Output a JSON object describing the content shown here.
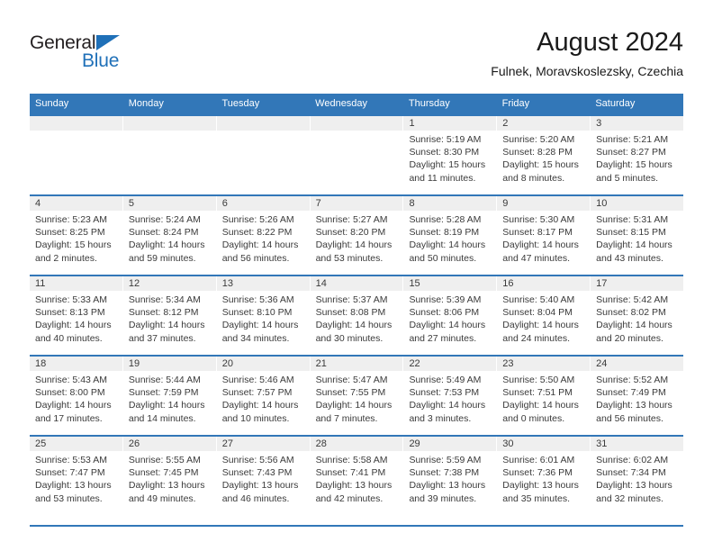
{
  "brand": {
    "name_primary": "General",
    "name_secondary": "Blue",
    "accent_color": "#1f70b8"
  },
  "header": {
    "title": "August 2024",
    "subtitle": "Fulnek, Moravskoslezsky, Czechia"
  },
  "theme": {
    "header_row_color": "#3277b8",
    "day_band_color": "#efefef",
    "text_color": "#3a3a3a"
  },
  "weekday_headers": [
    "Sunday",
    "Monday",
    "Tuesday",
    "Wednesday",
    "Thursday",
    "Friday",
    "Saturday"
  ],
  "weeks": [
    [
      {
        "day": "",
        "sunrise": "",
        "sunset": "",
        "daylight_line1": "",
        "daylight_line2": ""
      },
      {
        "day": "",
        "sunrise": "",
        "sunset": "",
        "daylight_line1": "",
        "daylight_line2": ""
      },
      {
        "day": "",
        "sunrise": "",
        "sunset": "",
        "daylight_line1": "",
        "daylight_line2": ""
      },
      {
        "day": "",
        "sunrise": "",
        "sunset": "",
        "daylight_line1": "",
        "daylight_line2": ""
      },
      {
        "day": "1",
        "sunrise": "Sunrise: 5:19 AM",
        "sunset": "Sunset: 8:30 PM",
        "daylight_line1": "Daylight: 15 hours",
        "daylight_line2": "and 11 minutes."
      },
      {
        "day": "2",
        "sunrise": "Sunrise: 5:20 AM",
        "sunset": "Sunset: 8:28 PM",
        "daylight_line1": "Daylight: 15 hours",
        "daylight_line2": "and 8 minutes."
      },
      {
        "day": "3",
        "sunrise": "Sunrise: 5:21 AM",
        "sunset": "Sunset: 8:27 PM",
        "daylight_line1": "Daylight: 15 hours",
        "daylight_line2": "and 5 minutes."
      }
    ],
    [
      {
        "day": "4",
        "sunrise": "Sunrise: 5:23 AM",
        "sunset": "Sunset: 8:25 PM",
        "daylight_line1": "Daylight: 15 hours",
        "daylight_line2": "and 2 minutes."
      },
      {
        "day": "5",
        "sunrise": "Sunrise: 5:24 AM",
        "sunset": "Sunset: 8:24 PM",
        "daylight_line1": "Daylight: 14 hours",
        "daylight_line2": "and 59 minutes."
      },
      {
        "day": "6",
        "sunrise": "Sunrise: 5:26 AM",
        "sunset": "Sunset: 8:22 PM",
        "daylight_line1": "Daylight: 14 hours",
        "daylight_line2": "and 56 minutes."
      },
      {
        "day": "7",
        "sunrise": "Sunrise: 5:27 AM",
        "sunset": "Sunset: 8:20 PM",
        "daylight_line1": "Daylight: 14 hours",
        "daylight_line2": "and 53 minutes."
      },
      {
        "day": "8",
        "sunrise": "Sunrise: 5:28 AM",
        "sunset": "Sunset: 8:19 PM",
        "daylight_line1": "Daylight: 14 hours",
        "daylight_line2": "and 50 minutes."
      },
      {
        "day": "9",
        "sunrise": "Sunrise: 5:30 AM",
        "sunset": "Sunset: 8:17 PM",
        "daylight_line1": "Daylight: 14 hours",
        "daylight_line2": "and 47 minutes."
      },
      {
        "day": "10",
        "sunrise": "Sunrise: 5:31 AM",
        "sunset": "Sunset: 8:15 PM",
        "daylight_line1": "Daylight: 14 hours",
        "daylight_line2": "and 43 minutes."
      }
    ],
    [
      {
        "day": "11",
        "sunrise": "Sunrise: 5:33 AM",
        "sunset": "Sunset: 8:13 PM",
        "daylight_line1": "Daylight: 14 hours",
        "daylight_line2": "and 40 minutes."
      },
      {
        "day": "12",
        "sunrise": "Sunrise: 5:34 AM",
        "sunset": "Sunset: 8:12 PM",
        "daylight_line1": "Daylight: 14 hours",
        "daylight_line2": "and 37 minutes."
      },
      {
        "day": "13",
        "sunrise": "Sunrise: 5:36 AM",
        "sunset": "Sunset: 8:10 PM",
        "daylight_line1": "Daylight: 14 hours",
        "daylight_line2": "and 34 minutes."
      },
      {
        "day": "14",
        "sunrise": "Sunrise: 5:37 AM",
        "sunset": "Sunset: 8:08 PM",
        "daylight_line1": "Daylight: 14 hours",
        "daylight_line2": "and 30 minutes."
      },
      {
        "day": "15",
        "sunrise": "Sunrise: 5:39 AM",
        "sunset": "Sunset: 8:06 PM",
        "daylight_line1": "Daylight: 14 hours",
        "daylight_line2": "and 27 minutes."
      },
      {
        "day": "16",
        "sunrise": "Sunrise: 5:40 AM",
        "sunset": "Sunset: 8:04 PM",
        "daylight_line1": "Daylight: 14 hours",
        "daylight_line2": "and 24 minutes."
      },
      {
        "day": "17",
        "sunrise": "Sunrise: 5:42 AM",
        "sunset": "Sunset: 8:02 PM",
        "daylight_line1": "Daylight: 14 hours",
        "daylight_line2": "and 20 minutes."
      }
    ],
    [
      {
        "day": "18",
        "sunrise": "Sunrise: 5:43 AM",
        "sunset": "Sunset: 8:00 PM",
        "daylight_line1": "Daylight: 14 hours",
        "daylight_line2": "and 17 minutes."
      },
      {
        "day": "19",
        "sunrise": "Sunrise: 5:44 AM",
        "sunset": "Sunset: 7:59 PM",
        "daylight_line1": "Daylight: 14 hours",
        "daylight_line2": "and 14 minutes."
      },
      {
        "day": "20",
        "sunrise": "Sunrise: 5:46 AM",
        "sunset": "Sunset: 7:57 PM",
        "daylight_line1": "Daylight: 14 hours",
        "daylight_line2": "and 10 minutes."
      },
      {
        "day": "21",
        "sunrise": "Sunrise: 5:47 AM",
        "sunset": "Sunset: 7:55 PM",
        "daylight_line1": "Daylight: 14 hours",
        "daylight_line2": "and 7 minutes."
      },
      {
        "day": "22",
        "sunrise": "Sunrise: 5:49 AM",
        "sunset": "Sunset: 7:53 PM",
        "daylight_line1": "Daylight: 14 hours",
        "daylight_line2": "and 3 minutes."
      },
      {
        "day": "23",
        "sunrise": "Sunrise: 5:50 AM",
        "sunset": "Sunset: 7:51 PM",
        "daylight_line1": "Daylight: 14 hours",
        "daylight_line2": "and 0 minutes."
      },
      {
        "day": "24",
        "sunrise": "Sunrise: 5:52 AM",
        "sunset": "Sunset: 7:49 PM",
        "daylight_line1": "Daylight: 13 hours",
        "daylight_line2": "and 56 minutes."
      }
    ],
    [
      {
        "day": "25",
        "sunrise": "Sunrise: 5:53 AM",
        "sunset": "Sunset: 7:47 PM",
        "daylight_line1": "Daylight: 13 hours",
        "daylight_line2": "and 53 minutes."
      },
      {
        "day": "26",
        "sunrise": "Sunrise: 5:55 AM",
        "sunset": "Sunset: 7:45 PM",
        "daylight_line1": "Daylight: 13 hours",
        "daylight_line2": "and 49 minutes."
      },
      {
        "day": "27",
        "sunrise": "Sunrise: 5:56 AM",
        "sunset": "Sunset: 7:43 PM",
        "daylight_line1": "Daylight: 13 hours",
        "daylight_line2": "and 46 minutes."
      },
      {
        "day": "28",
        "sunrise": "Sunrise: 5:58 AM",
        "sunset": "Sunset: 7:41 PM",
        "daylight_line1": "Daylight: 13 hours",
        "daylight_line2": "and 42 minutes."
      },
      {
        "day": "29",
        "sunrise": "Sunrise: 5:59 AM",
        "sunset": "Sunset: 7:38 PM",
        "daylight_line1": "Daylight: 13 hours",
        "daylight_line2": "and 39 minutes."
      },
      {
        "day": "30",
        "sunrise": "Sunrise: 6:01 AM",
        "sunset": "Sunset: 7:36 PM",
        "daylight_line1": "Daylight: 13 hours",
        "daylight_line2": "and 35 minutes."
      },
      {
        "day": "31",
        "sunrise": "Sunrise: 6:02 AM",
        "sunset": "Sunset: 7:34 PM",
        "daylight_line1": "Daylight: 13 hours",
        "daylight_line2": "and 32 minutes."
      }
    ]
  ]
}
